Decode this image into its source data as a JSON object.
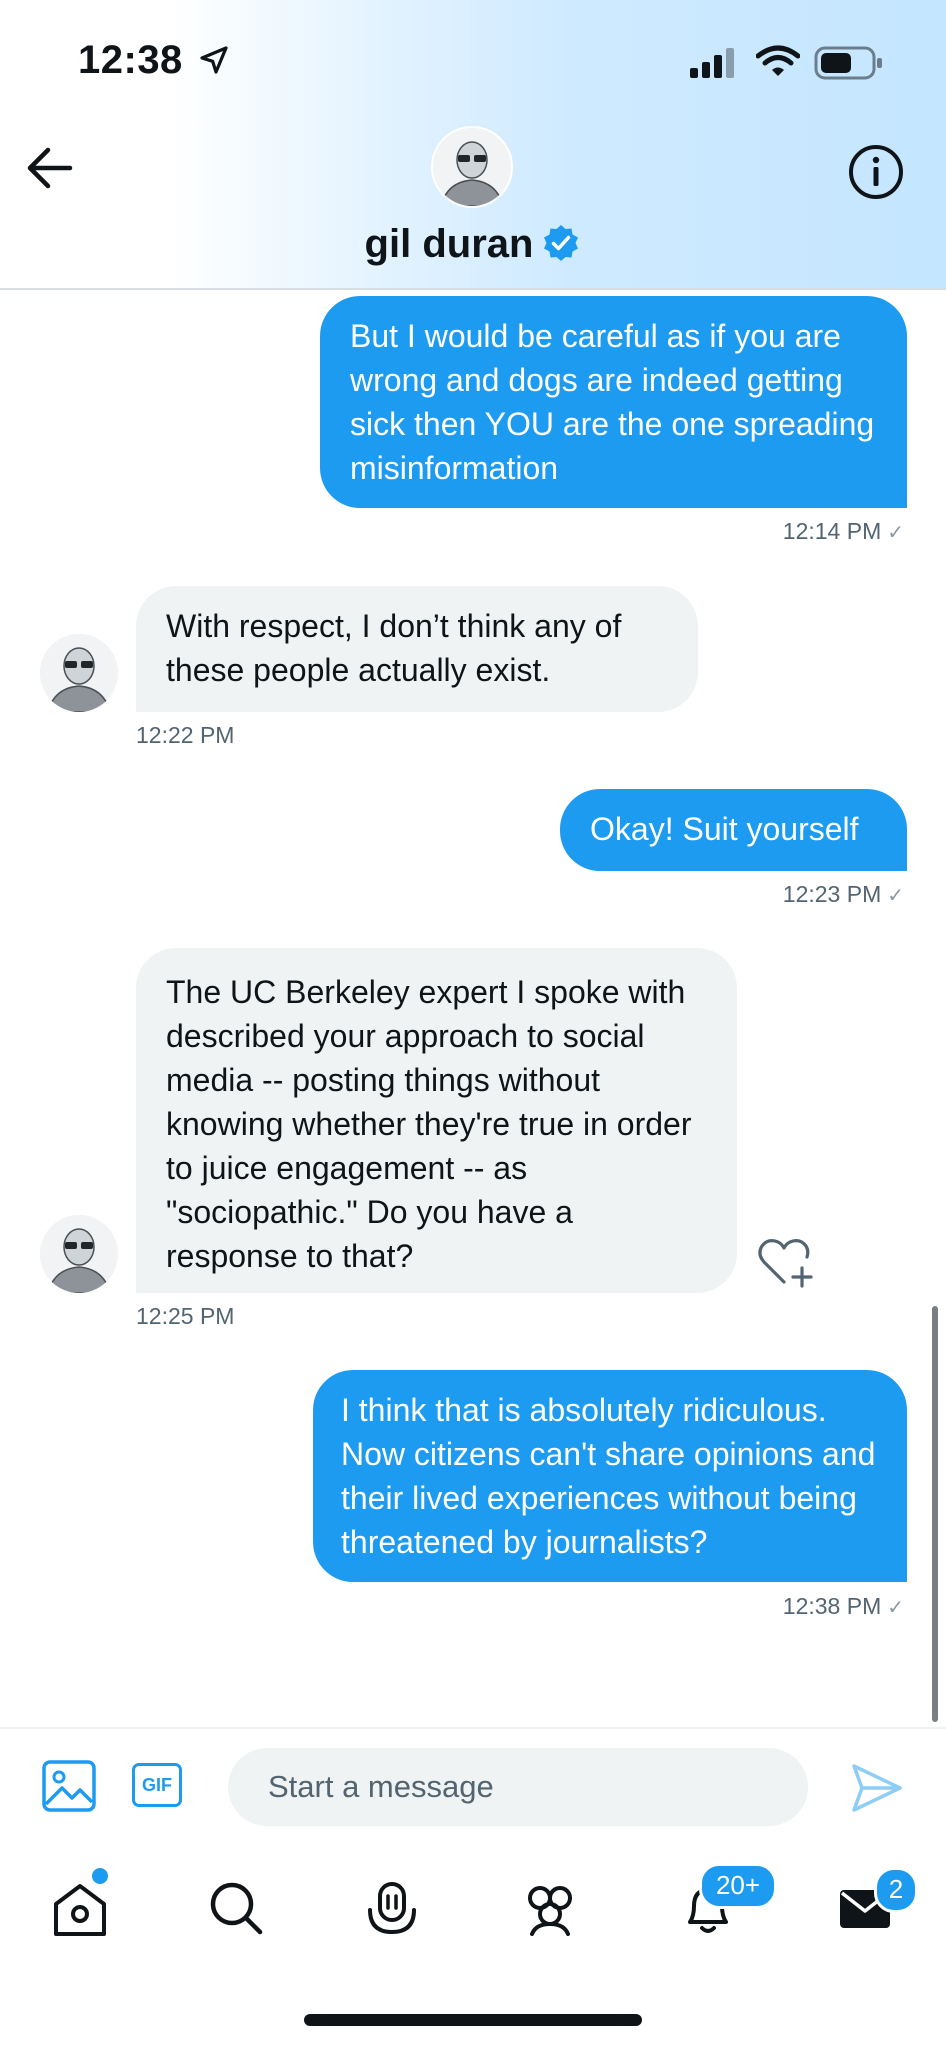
{
  "status_bar": {
    "time": "12:38"
  },
  "header": {
    "name": "gil duran"
  },
  "messages": [
    {
      "text": "But I would be careful as if you are wrong and dogs are indeed getting sick then YOU are the one spreading misinformation",
      "time": "12:14 PM",
      "check": "✓"
    },
    {
      "text": "With respect, I don’t think any of these people actually exist.",
      "time": "12:22 PM"
    },
    {
      "text": "Okay! Suit yourself",
      "time": "12:23 PM",
      "check": "✓"
    },
    {
      "text": "The UC Berkeley expert I spoke with described your approach to social media -- posting things without knowing whether they're true in order to juice engagement -- as \"sociopathic.\" Do you have a response to that?",
      "time": "12:25 PM"
    },
    {
      "text": "I think that is absolutely ridiculous. Now citizens can't share opinions and their lived experiences without being threatened by journalists?",
      "time": "12:38 PM",
      "check": "✓"
    }
  ],
  "composer": {
    "placeholder": "Start a message",
    "gif_label": "GIF"
  },
  "nav": {
    "notifications_badge": "20+",
    "messages_badge": "2"
  },
  "colors": {
    "accent": "#1d9bf0",
    "incoming_bubble": "#eff3f4",
    "text": "#0f1419",
    "secondary": "#536471"
  }
}
